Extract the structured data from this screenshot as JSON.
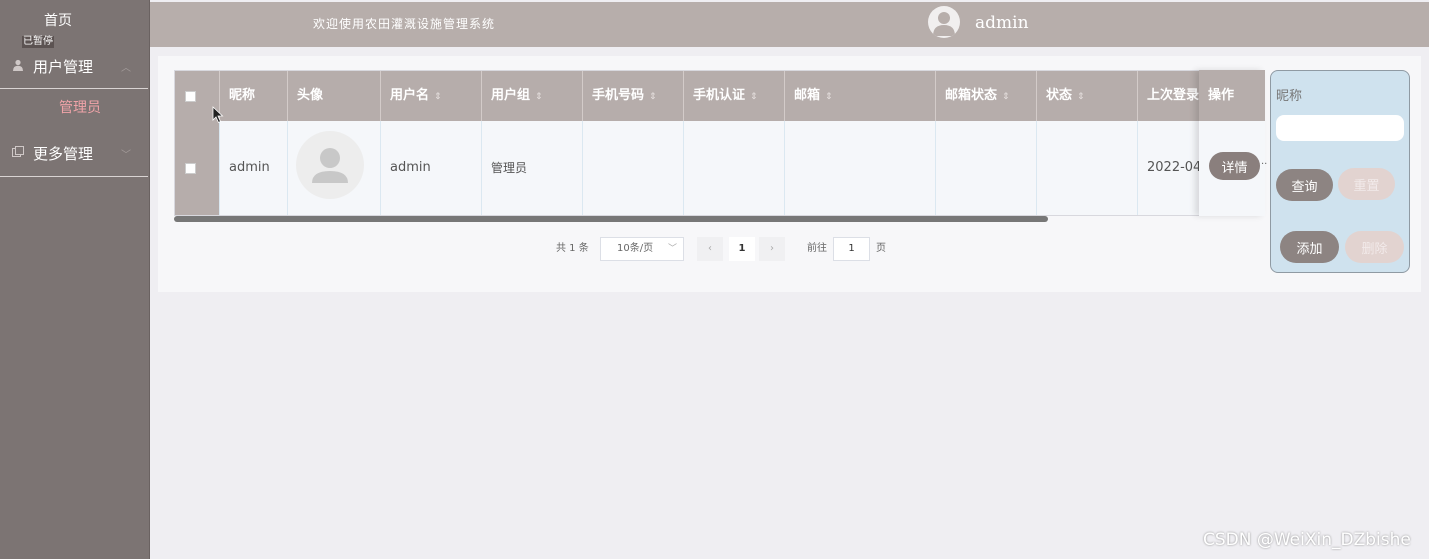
{
  "sidebar": {
    "home": "首页",
    "paused": "已暂停",
    "menus": [
      {
        "label": "用户管理",
        "icon": "user-icon"
      },
      {
        "label": "更多管理",
        "icon": "copy-icon"
      }
    ],
    "submenu_active": "管理员"
  },
  "header": {
    "welcome": "欢迎使用农田灌溉设施管理系统",
    "username": "admin"
  },
  "table": {
    "columns": [
      "昵称",
      "头像",
      "用户名",
      "用户组",
      "手机号码",
      "手机认证",
      "邮箱",
      "邮箱状态",
      "状态",
      "上次登录",
      "操作"
    ],
    "rows": [
      {
        "nickname": "admin",
        "username": "admin",
        "group": "管理员",
        "phone": "",
        "phone_verified": "",
        "email": "",
        "email_status": "",
        "status": "",
        "last_login": "2022-04-",
        "action": "详情",
        "ellipsis": ".."
      }
    ]
  },
  "pagination": {
    "total": "共 1 条",
    "page_size": "10条/页",
    "prev": "‹",
    "next": "›",
    "current": "1",
    "goto_label": "前往",
    "goto_value": "1",
    "page_suffix": "页"
  },
  "search_panel": {
    "label": "昵称",
    "placeholder": "",
    "query": "查询",
    "reset": "重置",
    "add": "添加",
    "delete": "删除"
  },
  "watermark": "CSDN @WeiXin_DZbishe"
}
